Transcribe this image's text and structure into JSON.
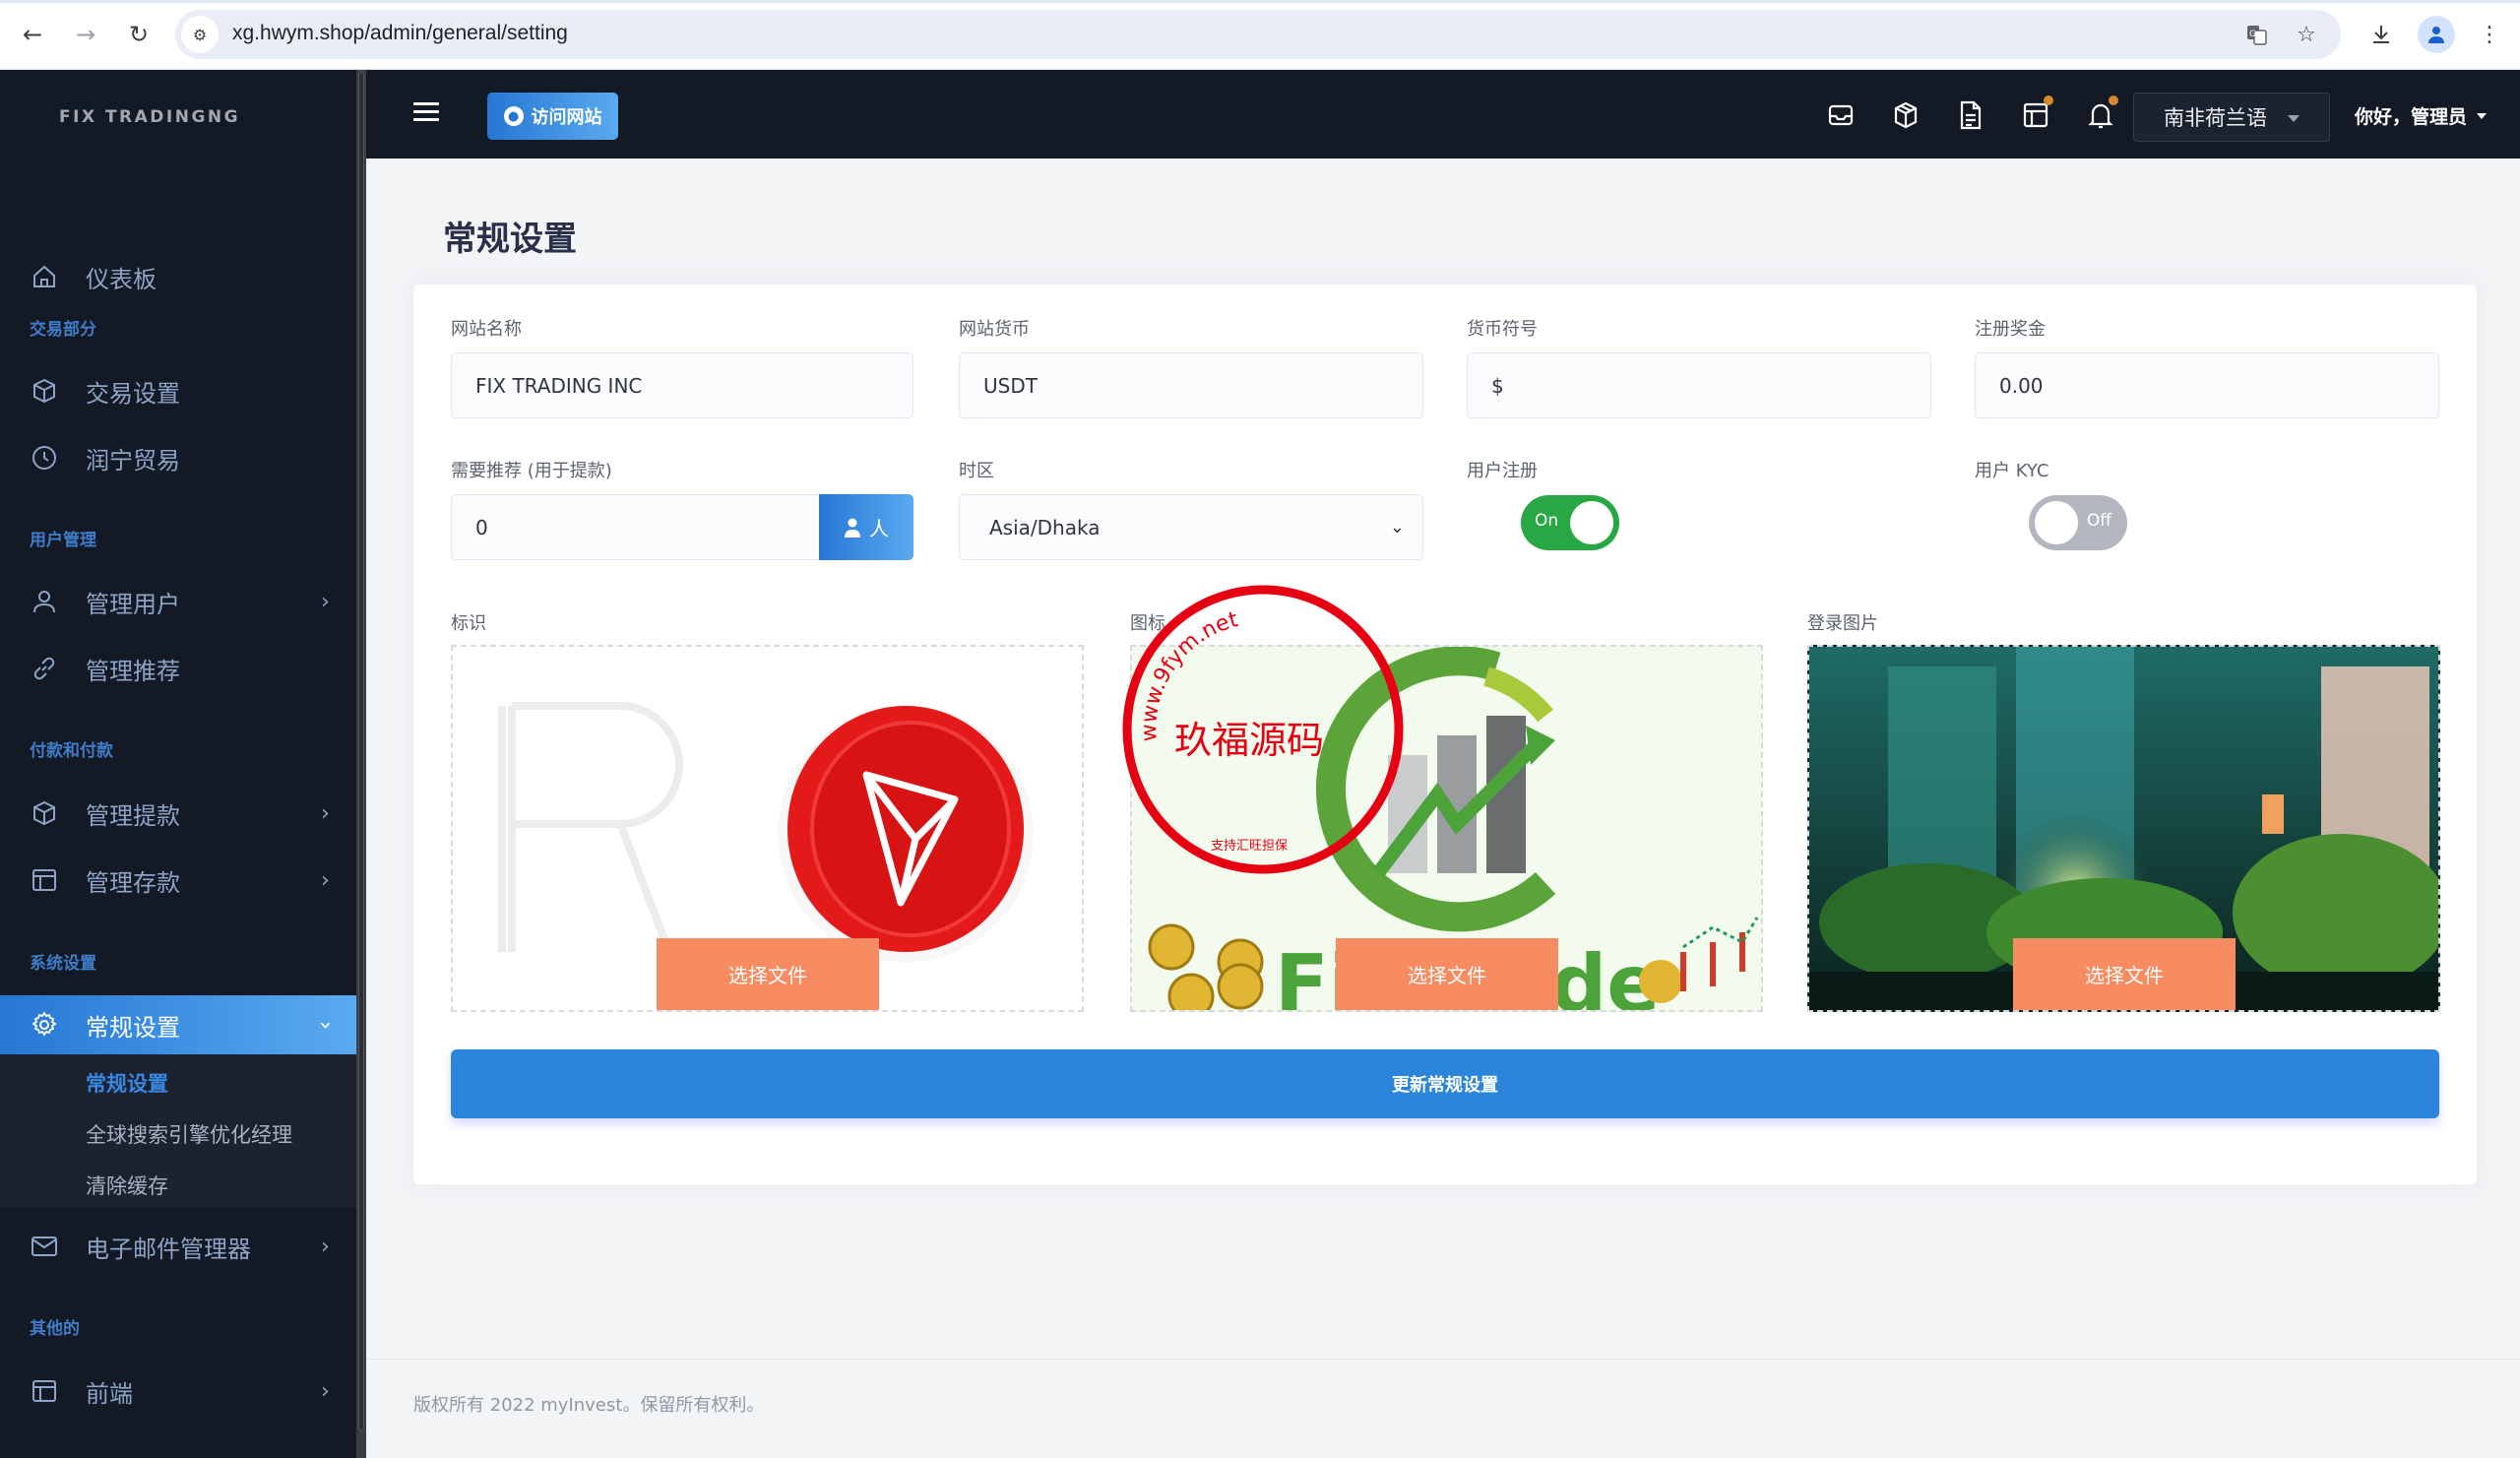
{
  "browser": {
    "url": "xg.hwym.shop/admin/general/setting",
    "icons": [
      "back-icon",
      "forward-icon",
      "reload-icon",
      "site-info-icon",
      "translate-icon",
      "bookmark-star-icon",
      "download-icon",
      "profile-icon",
      "more-menu-icon"
    ]
  },
  "sidebar": {
    "logo": "FIX TRADINGNG",
    "sections": [
      {
        "title": null,
        "items": [
          {
            "label": "仪表板",
            "icon": "home-icon",
            "has_children": false
          }
        ]
      },
      {
        "title": "交易部分",
        "items": [
          {
            "label": "交易设置",
            "icon": "cube-icon",
            "has_children": false
          },
          {
            "label": "润宁贸易",
            "icon": "clock-icon",
            "has_children": false
          }
        ]
      },
      {
        "title": "用户管理",
        "items": [
          {
            "label": "管理用户",
            "icon": "user-icon",
            "has_children": true
          },
          {
            "label": "管理推荐",
            "icon": "link-icon",
            "has_children": false
          }
        ]
      },
      {
        "title": "付款和付款",
        "items": [
          {
            "label": "管理提款",
            "icon": "cube-icon",
            "has_children": true
          },
          {
            "label": "管理存款",
            "icon": "table-icon",
            "has_children": true
          }
        ]
      },
      {
        "title": "系统设置",
        "items": [
          {
            "label": "常规设置",
            "icon": "gear-icon",
            "has_children": true,
            "active": true,
            "children": [
              {
                "label": "常规设置",
                "current": true
              },
              {
                "label": "全球搜索引擎优化经理",
                "current": false
              },
              {
                "label": "清除缓存",
                "current": false
              }
            ]
          },
          {
            "label": "电子邮件管理器",
            "icon": "mail-icon",
            "has_children": true
          }
        ]
      },
      {
        "title": "其他的",
        "items": [
          {
            "label": "前端",
            "icon": "layout-icon",
            "has_children": true
          }
        ]
      }
    ]
  },
  "header": {
    "visit_site_label": "访问网站",
    "icons": [
      {
        "name": "inbox-icon",
        "badge": false
      },
      {
        "name": "cube-icon",
        "badge": false
      },
      {
        "name": "document-icon",
        "badge": false
      },
      {
        "name": "layout-icon",
        "badge": true
      },
      {
        "name": "bell-icon",
        "badge": true
      }
    ],
    "language": "南非荷兰语",
    "greeting": "你好，管理员",
    "badge_color": "#d68a2e"
  },
  "page": {
    "title": "常规设置"
  },
  "form": {
    "site_name": {
      "label": "网站名称",
      "value": "FIX TRADING INC"
    },
    "site_currency": {
      "label": "网站货币",
      "value": "USDT"
    },
    "currency_symbol": {
      "label": "货币符号",
      "value": "$"
    },
    "signup_bonus": {
      "label": "注册奖金",
      "value": "0.00"
    },
    "referral_required": {
      "label": "需要推荐 (用于提款)",
      "value": "0",
      "addon": "人"
    },
    "timezone": {
      "label": "时区",
      "value": "Asia/Dhaka"
    },
    "user_registration": {
      "label": "用户注册",
      "state": true,
      "on_text": "On"
    },
    "user_kyc": {
      "label": "用户 KYC",
      "state": false,
      "off_text": "Off"
    },
    "logo": {
      "label": "标识",
      "button": "选择文件"
    },
    "favicon": {
      "label": "图标",
      "button": "选择文件",
      "watermark": {
        "center": "玖福源码",
        "ring": "www.9fym.net",
        "bottom": "支持汇旺担保"
      }
    },
    "login_image": {
      "label": "登录图片",
      "button": "选择文件"
    },
    "submit_label": "更新常规设置"
  },
  "footer": {
    "text": "版权所有 2022 myInvest。保留所有权利。"
  },
  "colors": {
    "sidebar_bg": "#131a26",
    "accent": "#2b85da",
    "toggle_on": "#28a745",
    "toggle_off": "#b2b7bf",
    "choose_file": "#f78b62"
  }
}
